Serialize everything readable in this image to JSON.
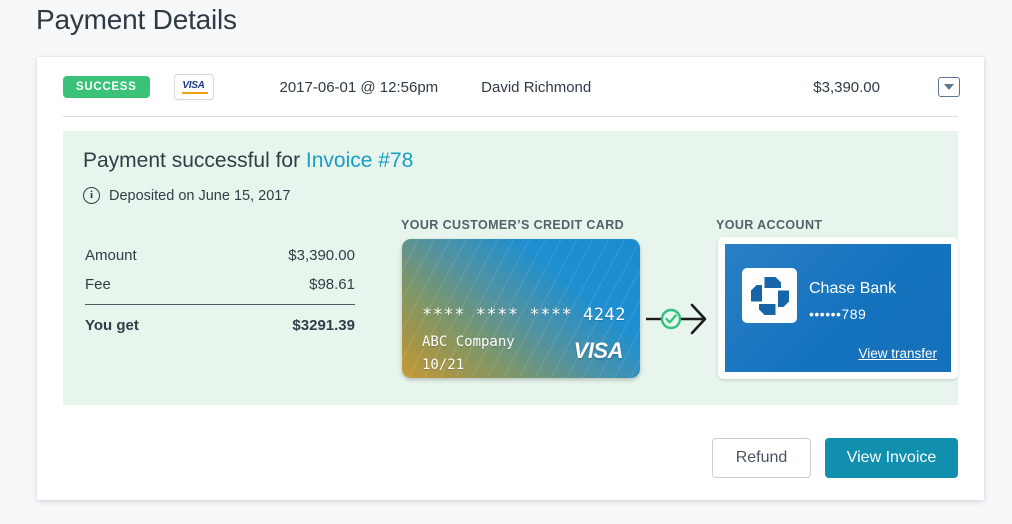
{
  "page_title": "Payment Details",
  "header": {
    "status_badge": "SUCCESS",
    "card_brand": "VISA",
    "date": "2017-06-01 @ 12:56pm",
    "customer_name": "David Richmond",
    "amount": "$3,390.00",
    "caret_icon": "chevron-down-icon"
  },
  "summary": {
    "headline_prefix": "Payment successful for ",
    "invoice_link": "Invoice #78",
    "deposit_note": "Deposited on June 15, 2017",
    "info_icon": "info-icon"
  },
  "amounts": {
    "rows": [
      {
        "label": "Amount",
        "value": "$3,390.00"
      },
      {
        "label": "Fee",
        "value": "$98.61"
      }
    ],
    "total_label": "You get",
    "total_value": "$3291.39"
  },
  "credit_card": {
    "section_label": "YOUR CUSTOMER’S CREDIT CARD",
    "number": "**** **** **** 4242",
    "holder": "ABC Company",
    "expiry": "10/21",
    "brand": "VISA"
  },
  "connector": {
    "check_icon": "check-circle-icon",
    "arrow_icon": "arrow-right-icon"
  },
  "account": {
    "section_label": "YOUR ACCOUNT",
    "bank_logo_icon": "chase-logo-icon",
    "bank_name": "Chase Bank",
    "account_number": "••••••789",
    "transfer_link": "View transfer"
  },
  "footer": {
    "refund_label": "Refund",
    "view_invoice_label": "View Invoice"
  },
  "colors": {
    "page_bg": "#f7f8fa",
    "success_green": "#3bc279",
    "panel_green": "#e7f5ed",
    "link_teal": "#18a0c4",
    "primary_button": "#118fae",
    "chase_blue": "#1573be"
  }
}
